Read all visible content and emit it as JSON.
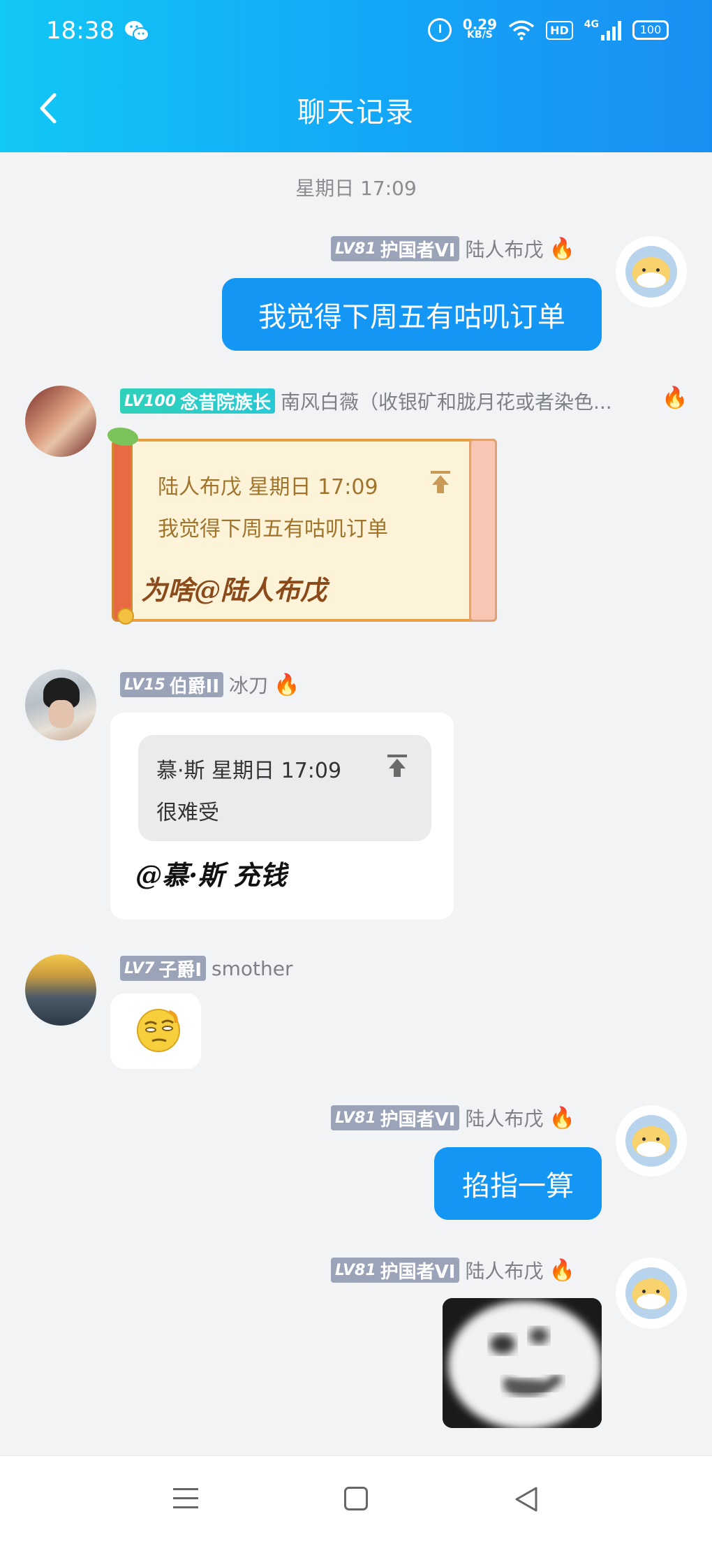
{
  "status_bar": {
    "time": "18:38",
    "net_speed_value": "0.29",
    "net_speed_unit": "KB/S",
    "hd_label": "HD",
    "network": "4G",
    "battery": "100"
  },
  "header": {
    "title": "聊天记录",
    "back_icon": "chevron-left-icon"
  },
  "chat": {
    "time_divider": "星期日 17:09",
    "messages": [
      {
        "side": "right",
        "badge_level": "LV81",
        "badge_title": "护国者VI",
        "sender": "陆人布戊",
        "text": "我觉得下周五有咕叽订单"
      },
      {
        "side": "left",
        "badge_level": "LV100",
        "badge_title": "念昔院族长",
        "sender": "南风白薇（收银矿和胧月花或者染色...",
        "quote_header": "陆人布戊 星期日 17:09",
        "quote_text": "我觉得下周五有咕叽订单",
        "text": "为啥@陆人布戊"
      },
      {
        "side": "left",
        "badge_level": "LV15",
        "badge_title": "伯爵II",
        "sender": "冰刀",
        "quote_header": "慕·斯 星期日 17:09",
        "quote_text": "很难受",
        "text": "@慕·斯 充钱"
      },
      {
        "side": "left",
        "badge_level": "LV7",
        "badge_title": "子爵I",
        "sender": "smother",
        "sticker": "thinking-emoji"
      },
      {
        "side": "right",
        "badge_level": "LV81",
        "badge_title": "护国者VI",
        "sender": "陆人布戊",
        "text": "掐指一算"
      },
      {
        "side": "right",
        "badge_level": "LV81",
        "badge_title": "护国者VI",
        "sender": "陆人布戊",
        "sticker": "blurry-face-meme"
      }
    ]
  },
  "colors": {
    "header_start": "#12c8f5",
    "header_end": "#1a8ff3",
    "bubble_blue": "#1496f4",
    "background": "#f2f3f5",
    "badge_gray": "#9aa3b8",
    "badge_green": "#2fd1b9"
  }
}
